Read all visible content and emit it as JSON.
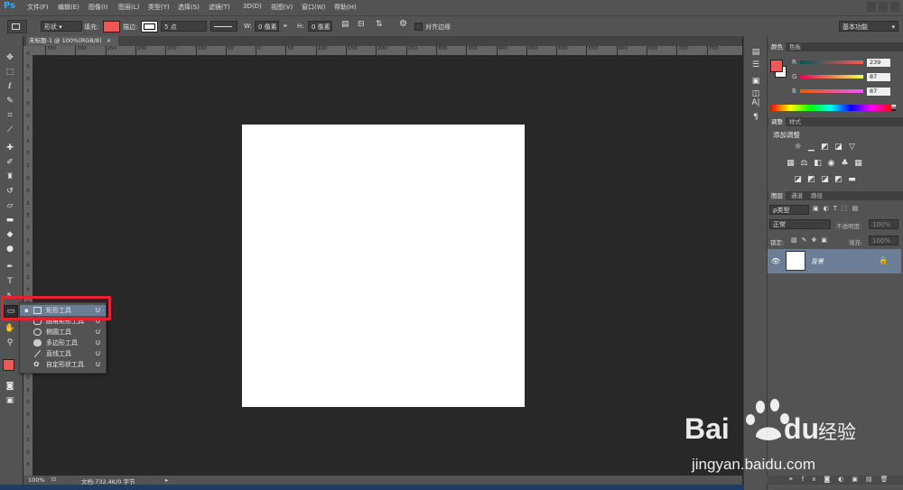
{
  "app": {
    "logo": "Ps",
    "workspace": "基本功能"
  },
  "menu": [
    "文件(F)",
    "编辑(E)",
    "图像(I)",
    "图层(L)",
    "类型(Y)",
    "选择(S)",
    "滤镜(T)",
    "3D(D)",
    "视图(V)",
    "窗口(W)",
    "帮助(H)"
  ],
  "options": {
    "mode": "形状",
    "fill_label": "填充:",
    "fill_color": "#ef5757",
    "stroke_label": "描边:",
    "stroke_size": "5 点",
    "w_label": "W:",
    "w_value": "0 像素",
    "h_label": "H:",
    "h_value": "0 像素",
    "align_edges": "对齐边缘"
  },
  "document": {
    "tab_title": "未标题-1 @ 100%(RGB/8)",
    "ruler_ticks": [
      "350",
      "300",
      "250",
      "200",
      "150",
      "100",
      "50",
      "0",
      "50",
      "100",
      "150",
      "200",
      "250",
      "300",
      "350",
      "400",
      "450",
      "500",
      "550",
      "600",
      "650",
      "700",
      "750"
    ],
    "ruler_v": [
      "0",
      "5",
      "0",
      "1",
      "0",
      "0",
      "1",
      "5",
      "0",
      "2",
      "0",
      "0",
      "2",
      "5",
      "0",
      "3",
      "0",
      "0",
      "3",
      "5",
      "0",
      "4",
      "0",
      "0",
      "4",
      "5",
      "0",
      "5",
      "0",
      "0",
      "5",
      "5",
      "0",
      "6"
    ],
    "zoom": "100%",
    "status": "文档:732.4K/0 字节"
  },
  "flyout": [
    {
      "label": "矩形工具",
      "key": "U",
      "icon": "rectangle-icon",
      "active": true
    },
    {
      "label": "圆角矩形工具",
      "key": "U",
      "icon": "rounded-rectangle-icon"
    },
    {
      "label": "椭圆工具",
      "key": "U",
      "icon": "ellipse-icon"
    },
    {
      "label": "多边形工具",
      "key": "U",
      "icon": "polygon-icon"
    },
    {
      "label": "直线工具",
      "key": "U",
      "icon": "line-icon"
    },
    {
      "label": "自定形状工具",
      "key": "U",
      "icon": "custom-shape-icon"
    }
  ],
  "color_panel": {
    "tabs": [
      "颜色",
      "色板"
    ],
    "channels": [
      {
        "label": "R",
        "value": "239"
      },
      {
        "label": "G",
        "value": "87"
      },
      {
        "label": "B",
        "value": "87"
      }
    ],
    "foreground": "#ef5757",
    "background": "#ffffff"
  },
  "adjust_panel": {
    "tabs": [
      "调整",
      "样式"
    ],
    "heading": "添加调整"
  },
  "layers_panel": {
    "tabs": [
      "图层",
      "通道",
      "路径"
    ],
    "filter": "ρ类型",
    "blend": "正常",
    "opacity_label": "不透明度:",
    "opacity_value": "100%",
    "lock_label": "锁定:",
    "fill_label": "填充:",
    "fill_value": "100%",
    "layer_name": "背景"
  },
  "watermark": {
    "brand": "Bai",
    "brand2": "du",
    "cn": "经验",
    "url": "jingyan.baidu.com"
  }
}
